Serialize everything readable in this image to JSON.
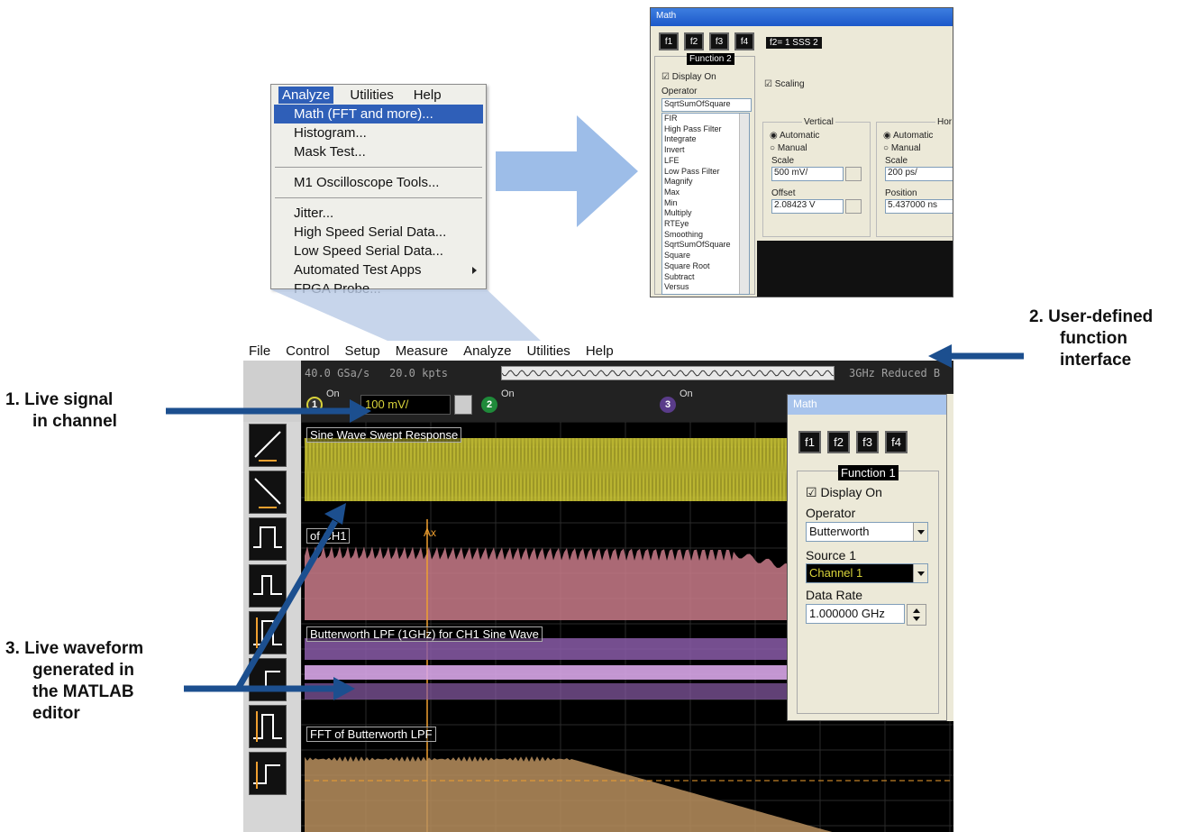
{
  "analyze_menu": {
    "header": [
      "Analyze",
      "Utilities",
      "Help"
    ],
    "items": [
      {
        "label": "Math (FFT and more)...",
        "highlighted": true
      },
      {
        "label": "Histogram..."
      },
      {
        "label": "Mask Test..."
      },
      {
        "sep": true
      },
      {
        "label": "M1 Oscilloscope Tools..."
      },
      {
        "sep": true
      },
      {
        "label": "Jitter..."
      },
      {
        "label": "High Speed Serial Data..."
      },
      {
        "label": "Low Speed Serial Data..."
      },
      {
        "label": "Automated Test Apps",
        "submenu": true
      },
      {
        "label": "FPGA Probe..."
      }
    ]
  },
  "math_top": {
    "title": "Math",
    "f_buttons": [
      "f1",
      "f2",
      "f3",
      "f4"
    ],
    "expression": "f2= 1   SSS   2",
    "function_label": "Function 2",
    "display_on": "Display On",
    "operator_label": "Operator",
    "operator_value": "SqrtSumOfSquare",
    "scaling": "Scaling",
    "operator_list": [
      "FIR",
      "High Pass Filter",
      "Integrate",
      "Invert",
      "LFE",
      "Low Pass Filter",
      "Magnify",
      "Max",
      "Min",
      "Multiply",
      "RTEye",
      "Smoothing",
      "SqrtSumOfSquare",
      "Square",
      "Square Root",
      "Subtract",
      "Versus"
    ],
    "vertical": {
      "label": "Vertical",
      "automatic": "Automatic",
      "manual": "Manual",
      "scale_label": "Scale",
      "scale": "500 mV/",
      "offset_label": "Offset",
      "offset": "2.08423 V"
    },
    "horizontal": {
      "label": "Hor",
      "automatic": "Automatic",
      "manual": "Manual",
      "scale_label": "Scale",
      "scale": "200 ps/",
      "position_label": "Position",
      "position": "5.437000 ns"
    }
  },
  "scope": {
    "menubar": [
      "File",
      "Control",
      "Setup",
      "Measure",
      "Analyze",
      "Utilities",
      "Help"
    ],
    "status": {
      "sample_rate": "40.0 GSa/s",
      "points": "20.0 kpts",
      "mode": "3GHz Reduced B"
    },
    "channels": [
      {
        "num": "1",
        "on": "On",
        "scale": "100 mV/"
      },
      {
        "num": "2",
        "on": "On"
      },
      {
        "num": "3",
        "on": "On"
      }
    ],
    "waveforms": [
      {
        "label": "Sine Wave Swept Response",
        "color": "#d9d33a"
      },
      {
        "label": "of CH1",
        "color": "#c97b8a"
      },
      {
        "label": "Butterworth LPF (1GHz) for CH1 Sine Wave",
        "color": "#8a5ca8"
      },
      {
        "label": "FFT of Butterworth LPF",
        "color": "#b98f5e"
      }
    ],
    "marker": "Ax"
  },
  "math_bottom": {
    "title": "Math",
    "f_buttons": [
      "f1",
      "f2",
      "f3",
      "f4"
    ],
    "function_label": "Function 1",
    "display_on": "Display On",
    "operator_label": "Operator",
    "operator_value": "Butterworth",
    "source_label": "Source 1",
    "source_value": "Channel 1",
    "data_rate_label": "Data Rate",
    "data_rate_value": "1.000000 GHz"
  },
  "callouts": {
    "c1": [
      "1.  Live signal",
      "in channel"
    ],
    "c2": [
      "2.  User-defined",
      "function",
      "interface"
    ],
    "c3": [
      "3.  Live waveform",
      "generated in",
      "the MATLAB",
      "editor"
    ]
  },
  "colors": {
    "arrow": "#1c4f8f",
    "menu_highlight": "#2f5fb8"
  }
}
